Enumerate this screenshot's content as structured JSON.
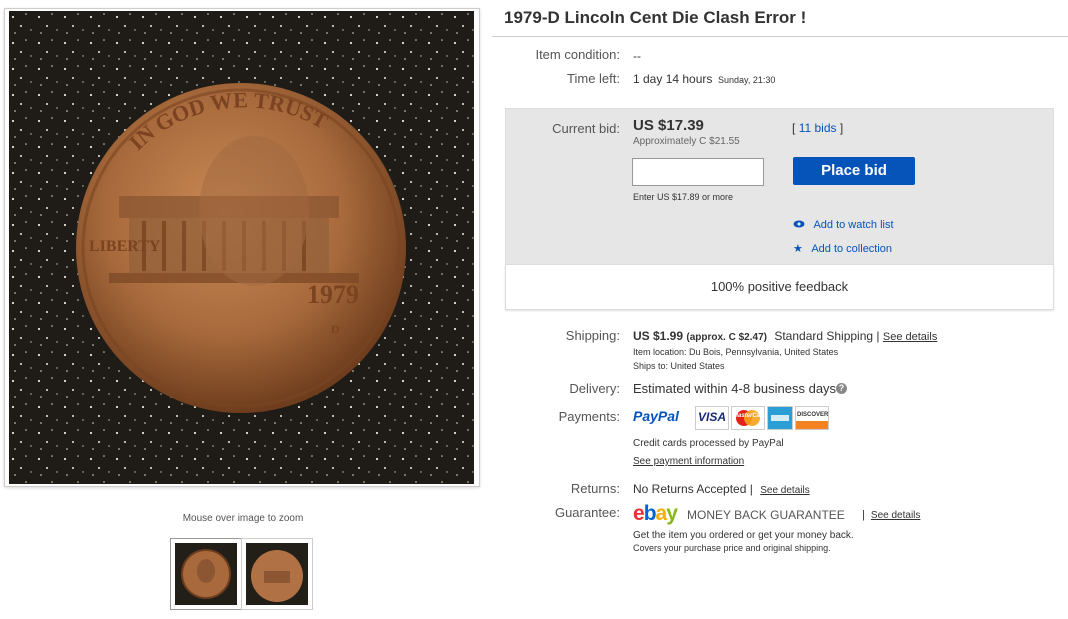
{
  "listing": {
    "title": "1979-D Lincoln Cent Die Clash Error !",
    "image_hint": "Mouse over image to zoom"
  },
  "details": {
    "condition_label": "Item condition:",
    "condition_value": "--",
    "time_left_label": "Time left:",
    "time_left_value": "1 day 14 hours",
    "time_left_end": "Sunday, 21:30"
  },
  "bid": {
    "current_label": "Current bid:",
    "current_value": "US $17.39",
    "approx": "Approximately C $21.55",
    "bids_open": "[",
    "bids_link": "11 bids",
    "bids_close": "]",
    "input_placeholder": "",
    "hint": "Enter US $17.89 or more",
    "place_bid_label": "Place bid",
    "watch_label": "Add to watch list",
    "collection_label": "Add to collection",
    "feedback": "100% positive feedback"
  },
  "shipping": {
    "label": "Shipping:",
    "cost": "US $1.99",
    "approx": "(approx. C $2.47)",
    "service": "Standard Shipping",
    "sep": "|",
    "details_link": "See details",
    "location": "Item location:  Du Bois, Pennsylvania, United States",
    "ships_to": "Ships to:  United States"
  },
  "delivery": {
    "label": "Delivery:",
    "value": "Estimated within 4-8 business days"
  },
  "payments": {
    "label": "Payments:",
    "paypal": "PayPal",
    "visa": "VISA",
    "mastercard": "MasterCard",
    "discover": "DISCOVER",
    "note": "Credit cards processed by PayPal",
    "info_link": "See payment information"
  },
  "returns": {
    "label": "Returns:",
    "value": "No Returns Accepted",
    "sep": "|",
    "details_link": "See details"
  },
  "guarantee": {
    "label": "Guarantee:",
    "brand": [
      "e",
      "b",
      "a",
      "y"
    ],
    "mbg": "MONEY BACK GUARANTEE",
    "sep": "|",
    "details_link": "See details",
    "line1": "Get the item you ordered or get your money back.",
    "line2": "Covers your purchase price and original shipping."
  },
  "coin_text": {
    "motto": "IN GOD WE TRUST",
    "liberty": "LIBERTY",
    "year": "1979",
    "mint": "D"
  },
  "colors": {
    "accent": "#0654ba",
    "panel": "#e6e6e6",
    "coin": "#a86a3c"
  }
}
